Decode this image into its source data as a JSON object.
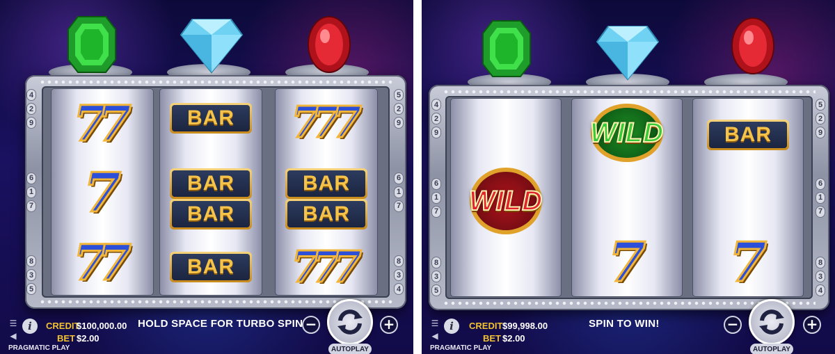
{
  "left": {
    "gems": [
      "emerald",
      "diamond",
      "ruby"
    ],
    "paylines_left": [
      [
        "4",
        "2",
        "9"
      ],
      [
        "6",
        "1",
        "7"
      ],
      [
        "8",
        "3",
        "5"
      ]
    ],
    "paylines_right": [
      [
        "5",
        "2",
        "9"
      ],
      [
        "6",
        "1",
        "7"
      ],
      [
        "8",
        "3",
        "4"
      ]
    ],
    "reels": [
      [
        {
          "type": "seven",
          "count": 2
        },
        {
          "type": "seven",
          "count": 1
        },
        {
          "type": "seven",
          "count": 2
        }
      ],
      [
        {
          "type": "bar",
          "text": "BAR"
        },
        {
          "type": "bar",
          "text": "BAR"
        },
        {
          "type": "bar",
          "text": "BAR"
        },
        {
          "type": "bar",
          "text": "BAR"
        }
      ],
      [
        {
          "type": "seven",
          "count": 3
        },
        {
          "type": "bar",
          "text": "BAR"
        },
        {
          "type": "bar",
          "text": "BAR"
        },
        {
          "type": "seven",
          "count": 3
        }
      ]
    ],
    "hud": {
      "credit_label": "CREDIT",
      "credit_value": "$100,000.00",
      "bet_label": "BET",
      "bet_value": "$2.00",
      "provider": "PRAGMATIC PLAY",
      "message": "HOLD SPACE FOR TURBO SPIN",
      "minus_label": "−",
      "plus_label": "+",
      "autoplay_label": "AUTOPLAY",
      "info_label": "i"
    }
  },
  "right": {
    "gems": [
      "emerald",
      "diamond",
      "ruby"
    ],
    "paylines_left": [
      [
        "4",
        "2",
        "9"
      ],
      [
        "6",
        "1",
        "7"
      ],
      [
        "8",
        "3",
        "5"
      ]
    ],
    "paylines_right": [
      [
        "5",
        "2",
        "9"
      ],
      [
        "6",
        "1",
        "7"
      ],
      [
        "8",
        "3",
        "4"
      ]
    ],
    "symbols": {
      "wild_red": "WILD",
      "wild_green": "WILD",
      "bar": "BAR",
      "seven": "7"
    },
    "hud": {
      "credit_label": "CREDIT",
      "credit_value": "$99,998.00",
      "bet_label": "BET",
      "bet_value": "$2.00",
      "provider": "PRAGMATIC PLAY",
      "message": "SPIN TO WIN!",
      "minus_label": "−",
      "plus_label": "+",
      "autoplay_label": "AUTOPLAY",
      "info_label": "i"
    }
  },
  "colors": {
    "credit_label": "#f2c233",
    "bar_text": "#f5c24a",
    "seven_blue": "#2b4fd8",
    "wild_red": "#e0242f",
    "wild_green": "#36c93a",
    "emerald": "#2fcf3c",
    "diamond": "#7fd8f5",
    "ruby": "#d81c2a"
  }
}
